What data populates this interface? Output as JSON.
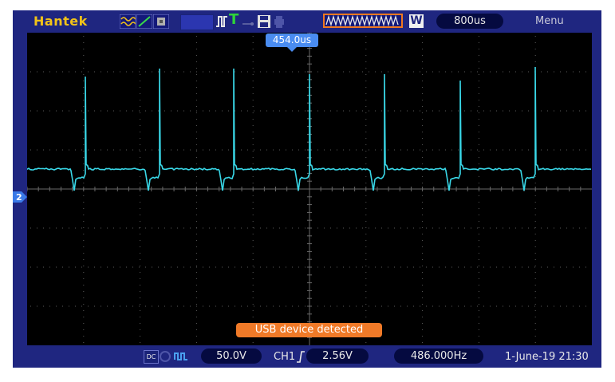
{
  "brand": "Hantek",
  "topbar": {
    "icons": [
      "signal-wave-icon",
      "ramp-icon",
      "cursor-icon",
      "trigger-pulse-icon",
      "trigger-icon",
      "link-icon",
      "save-icon",
      "print-icon",
      "waveform-zoom-icon",
      "w-icon"
    ],
    "trigger_type_label": "⎍",
    "trigger_source_letter": "T",
    "waveform_mark_letter": "W",
    "timebase": "800us",
    "menu_label": "Menu"
  },
  "trigger_position_marker": "454.0us",
  "status_message": "USB device detected",
  "bottombar": {
    "coupling_label": "DC",
    "volts_div": "50.0V",
    "trigger_channel": "CH1",
    "trigger_level": "2.56V",
    "frequency": "486.000Hz",
    "datetime": "1-June-19 21:30"
  },
  "channel_marker": "2",
  "colors": {
    "frame": "#1f2680",
    "trace": "#39d8e8",
    "brand": "#f2c318",
    "status_bg": "#f07a28",
    "marker_bg": "#4a8cf0"
  }
}
